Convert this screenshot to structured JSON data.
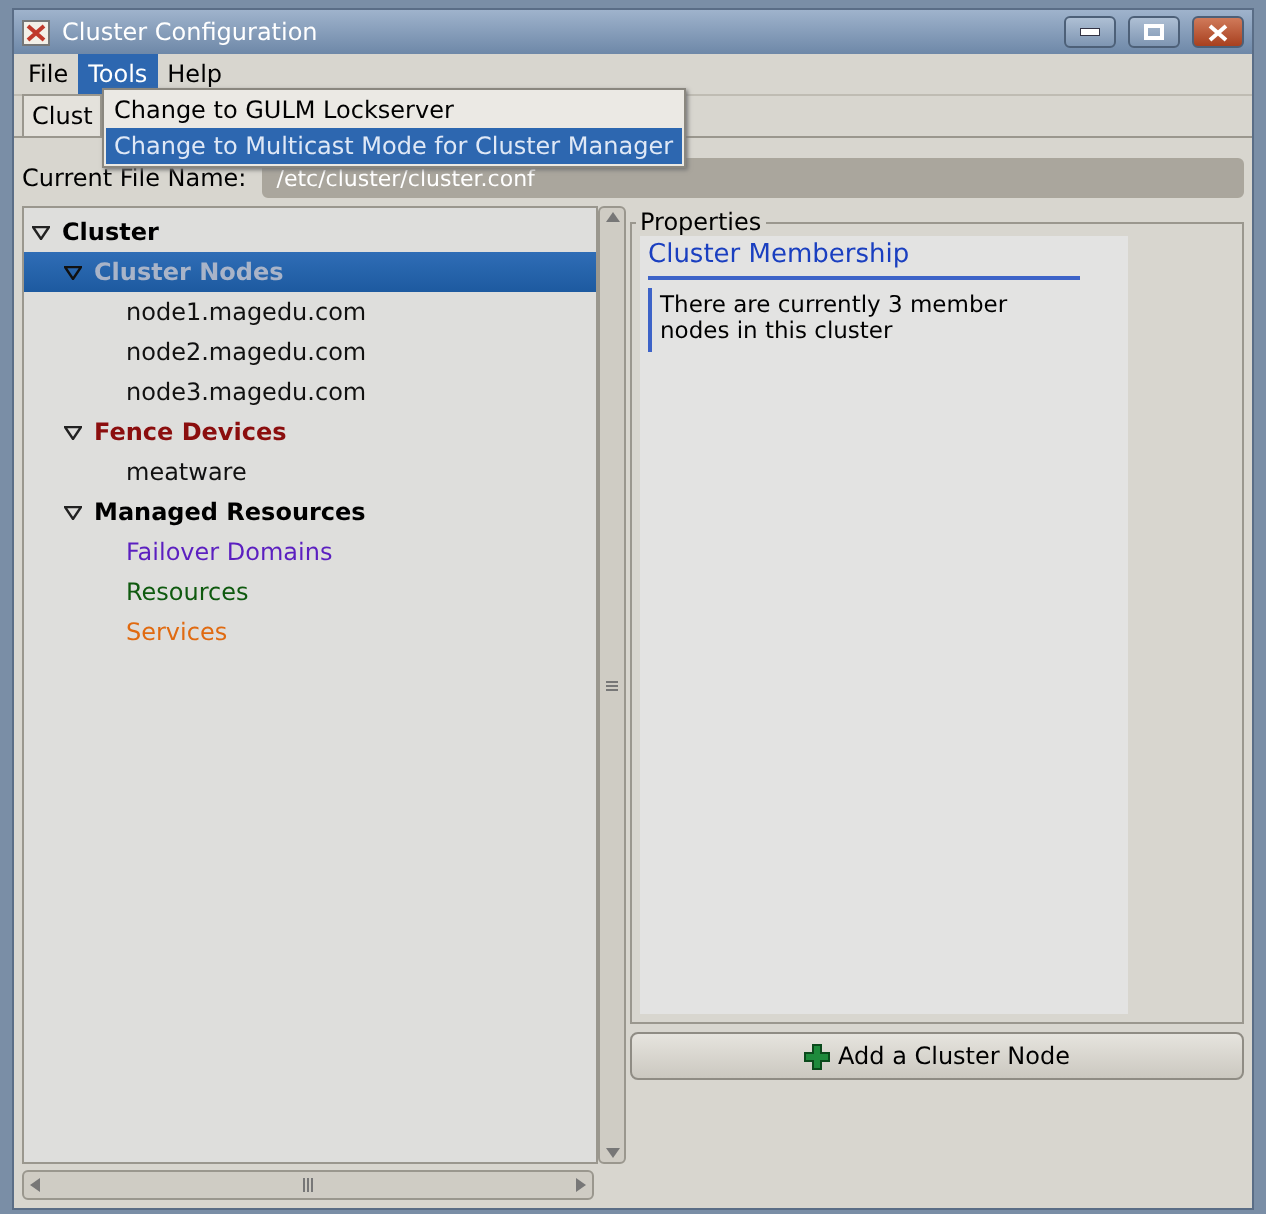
{
  "window": {
    "title": "Cluster Configuration"
  },
  "menu": [
    {
      "label": "File",
      "selected": false
    },
    {
      "label": "Tools",
      "selected": true
    },
    {
      "label": "Help",
      "selected": false
    }
  ],
  "dropdown": [
    {
      "label": "Change to GULM Lockserver",
      "selected": false
    },
    {
      "label": "Change to Multicast Mode for Cluster Manager",
      "selected": true
    }
  ],
  "tab": {
    "label": "Clust"
  },
  "file_name": {
    "label": "Current File Name:",
    "value": "/etc/cluster/cluster.conf"
  },
  "tree": [
    {
      "label": "Cluster",
      "color": "#000000",
      "selected": false,
      "expanded": true,
      "children": [
        {
          "label": "Cluster Nodes",
          "color": "#a9b4c8",
          "selected": true,
          "expanded": true,
          "children": [
            {
              "label": "node1.magedu.com",
              "color": "#111111",
              "selected": false
            },
            {
              "label": "node2.magedu.com",
              "color": "#111111",
              "selected": false
            },
            {
              "label": "node3.magedu.com",
              "color": "#111111",
              "selected": false
            }
          ]
        },
        {
          "label": "Fence Devices",
          "color": "#8b0e0e",
          "selected": false,
          "expanded": true,
          "children": [
            {
              "label": "meatware",
              "color": "#111111",
              "selected": false
            }
          ]
        },
        {
          "label": "Managed Resources",
          "color": "#000000",
          "selected": false,
          "expanded": true,
          "children": [
            {
              "label": "Failover Domains",
              "color": "#5b1fc0",
              "selected": false
            },
            {
              "label": "Resources",
              "color": "#0f5a0f",
              "selected": false
            },
            {
              "label": "Services",
              "color": "#e06a10",
              "selected": false
            }
          ]
        }
      ]
    }
  ],
  "properties": {
    "legend": "Properties",
    "heading": "Cluster Membership",
    "text": "There are currently 3 member nodes in this cluster",
    "button": "Add a Cluster Node"
  }
}
